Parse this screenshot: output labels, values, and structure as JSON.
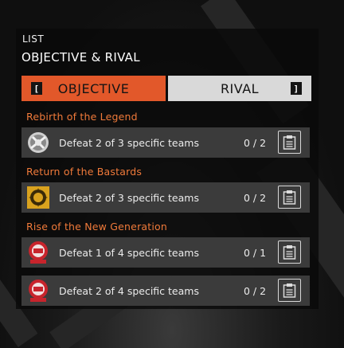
{
  "header": {
    "small": "LIST",
    "title": "OBJECTIVE & RIVAL"
  },
  "tabs": {
    "objective": {
      "label": "OBJECTIVE",
      "key": "["
    },
    "rival": {
      "label": "RIVAL",
      "key": "]"
    }
  },
  "groups": [
    {
      "title": "Rebirth of the Legend",
      "items": [
        {
          "description": "Defeat 2 of 3 specific teams",
          "progress": "0 / 2",
          "emblem": "rebirth-emblem-icon"
        }
      ]
    },
    {
      "title": "Return of the Bastards",
      "items": [
        {
          "description": "Defeat 2 of 3 specific teams",
          "progress": "0 / 2",
          "emblem": "bastards-emblem-icon"
        }
      ]
    },
    {
      "title": "Rise of the New Generation",
      "items": [
        {
          "description": "Defeat 1 of 4 specific teams",
          "progress": "0 / 1",
          "emblem": "new-generation-emblem-icon"
        },
        {
          "description": "Defeat 2 of 4 specific teams",
          "progress": "0 / 2",
          "emblem": "new-generation-emblem-icon"
        }
      ]
    }
  ],
  "colors": {
    "accent": "#e2582a",
    "group_title": "#f07a3a",
    "row_bg": "#3b3b3b",
    "tab_inactive": "#d9d9d9"
  }
}
